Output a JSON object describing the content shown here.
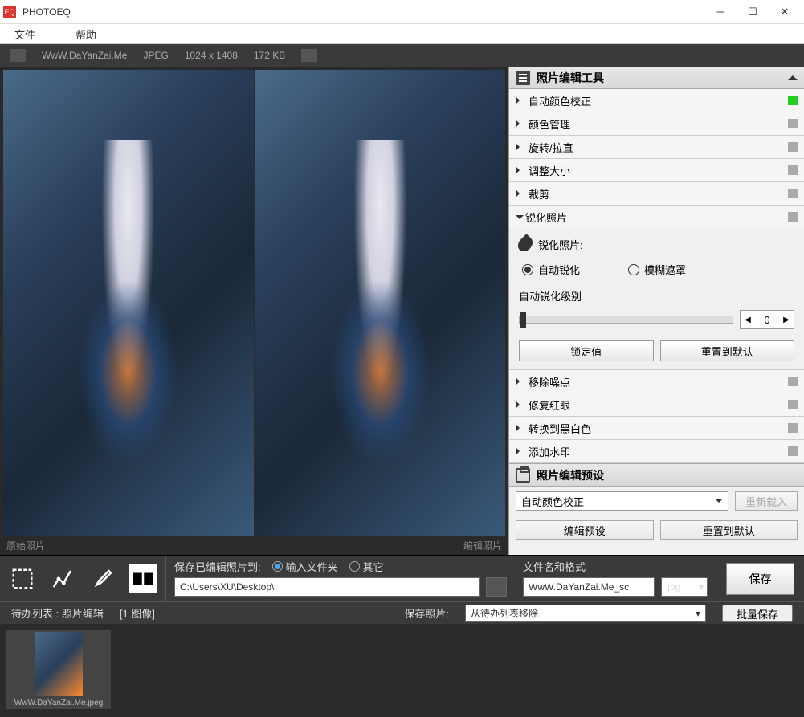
{
  "title": "PHOTOEQ",
  "menu": {
    "file": "文件",
    "help": "帮助"
  },
  "info": {
    "name": "WwW.DaYanZai.Me",
    "format": "JPEG",
    "dims": "1024 x 1408",
    "size": "172 KB"
  },
  "preview": {
    "left": "原始照片",
    "right": "编辑照片"
  },
  "panel": {
    "title": "照片编辑工具",
    "items": [
      {
        "label": "自动颜色校正",
        "active": true
      },
      {
        "label": "颜色管理",
        "active": false
      },
      {
        "label": "旋转/拉直",
        "active": false
      },
      {
        "label": "调整大小",
        "active": false
      },
      {
        "label": "裁剪",
        "active": false
      }
    ],
    "sharpen": {
      "label": "锐化照片",
      "section_title": "锐化照片:",
      "auto": "自动锐化",
      "unsharp": "模糊遮罩",
      "level_label": "自动锐化级别",
      "value": "0",
      "lock": "锁定值",
      "reset": "重置到默认"
    },
    "items2": [
      {
        "label": "移除噪点"
      },
      {
        "label": "修复红眼"
      },
      {
        "label": "转换到黑白色"
      },
      {
        "label": "添加水印"
      }
    ],
    "preset": {
      "title": "照片编辑预设",
      "selected": "自动颜色校正",
      "reload": "重新载入",
      "edit": "编辑预设",
      "reset": "重置到默认"
    }
  },
  "save": {
    "label": "保存已编辑照片到:",
    "opt1": "输入文件夹",
    "opt2": "其它",
    "path": "C:\\Users\\XU\\Desktop\\",
    "filename_label": "文件名和格式",
    "filename": "WwW.DaYanZai.Me_sc",
    "format": ".jpg",
    "button": "保存"
  },
  "queue": {
    "label": "待办列表 : 照片编辑",
    "count": "[1 图像]",
    "save_label": "保存照片:",
    "action": "从待办列表移除",
    "batch": "批量保存"
  },
  "thumb": {
    "name": "WwW.DaYanZai.Me.jpeg"
  }
}
